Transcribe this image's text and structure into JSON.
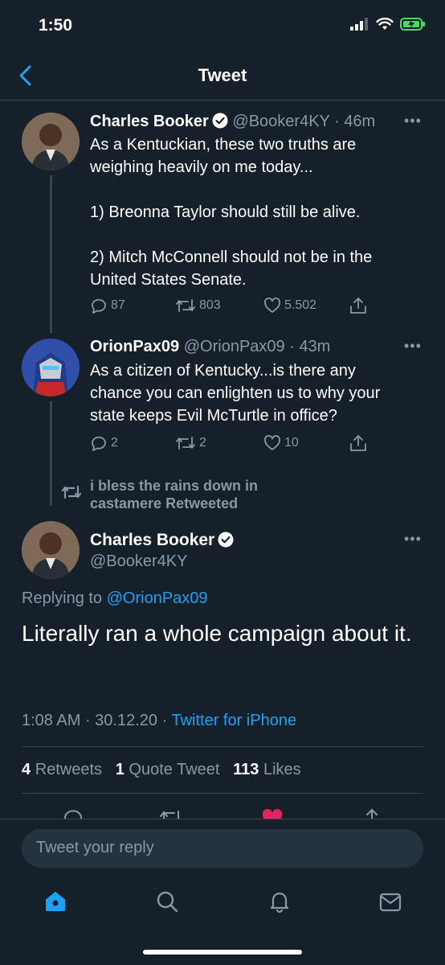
{
  "status_bar": {
    "time": "1:50"
  },
  "header": {
    "title": "Tweet"
  },
  "tweets": [
    {
      "name": "Charles Booker",
      "handle": "@Booker4KY",
      "time": "46m",
      "text": "As a Kentuckian, these two truths are\nweighing heavily on me today...\n\n1) Breonna Taylor should still be alive.\n\n2) Mitch McConnell should not be in the\nUnited States Senate.",
      "replies": "87",
      "retweets": "803",
      "likes": "5.502"
    },
    {
      "name": "OrionPax09",
      "handle": "@OrionPax09",
      "time": "43m",
      "text": "As a citizen of Kentucky...is there any\nchance you can enlighten us to why your\nstate keeps Evil McTurtle in office?",
      "replies": "2",
      "retweets": "2",
      "likes": "10"
    }
  ],
  "retweet_note": {
    "line1": "i bless the rains down in",
    "line2": "castamere Retweeted"
  },
  "main_tweet": {
    "name": "Charles Booker",
    "handle": "@Booker4KY",
    "replying_label": "Replying to",
    "replying_handle": "@OrionPax09",
    "text": "Literally ran a whole campaign about it.",
    "time": "1:08 AM",
    "date": "30.12.20",
    "source": "Twitter for iPhone",
    "retweets_count": "4",
    "retweets_label": "Retweets",
    "quotes_count": "1",
    "quotes_label": "Quote Tweet",
    "likes_count": "113",
    "likes_label": "Likes"
  },
  "reply_box": {
    "placeholder": "Tweet your reply"
  },
  "colors": {
    "background": "#15202b",
    "accent": "#1da1f2",
    "like": "#e0245e",
    "muted": "#8899a6"
  }
}
